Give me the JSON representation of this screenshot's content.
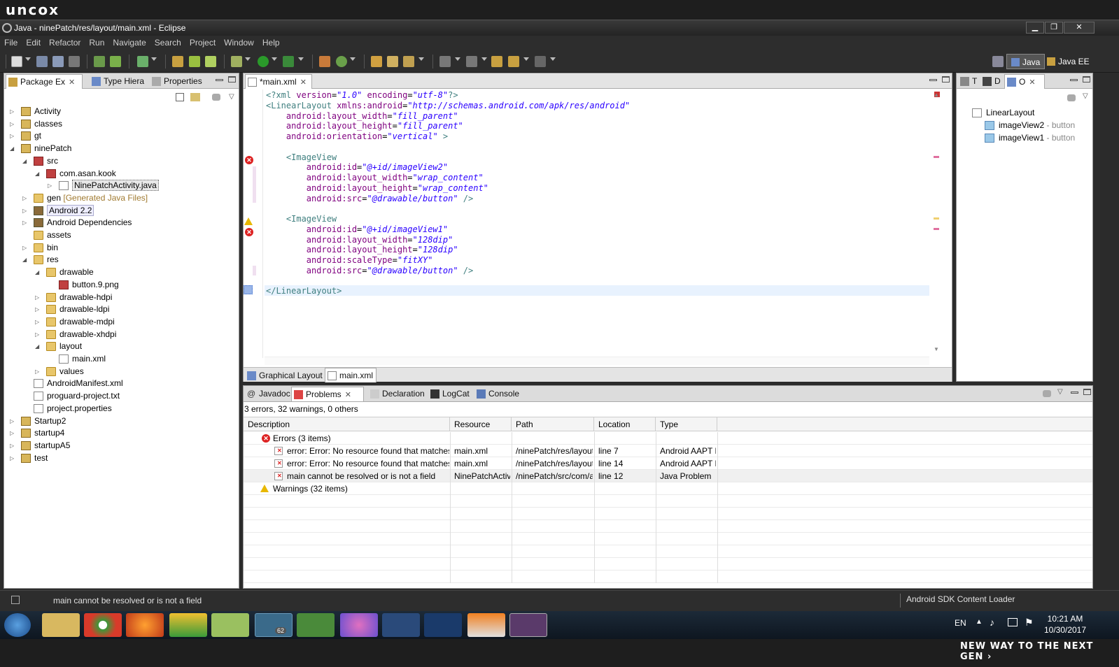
{
  "brand": {
    "logo": "uncox",
    "tagline": "NEW WAY TO THE NEXT GEN ›"
  },
  "window": {
    "title": "Java - ninePatch/res/layout/main.xml - Eclipse",
    "min": "▁",
    "max": "❐",
    "close": "✕"
  },
  "menu": [
    "File",
    "Edit",
    "Refactor",
    "Run",
    "Navigate",
    "Search",
    "Project",
    "Window",
    "Help"
  ],
  "perspectives": {
    "java": "Java",
    "javaee": "Java EE"
  },
  "left_panel": {
    "tabs": [
      {
        "label": "Package Ex"
      },
      {
        "label": "Type Hiera"
      },
      {
        "label": "Properties"
      }
    ],
    "tree": [
      {
        "label": "Activity",
        "level": 0,
        "twisty": "▷",
        "icon": "proj"
      },
      {
        "label": "classes",
        "level": 0,
        "twisty": "▷",
        "icon": "proj"
      },
      {
        "label": "gt",
        "level": 0,
        "twisty": "▷",
        "icon": "proj"
      },
      {
        "label": "ninePatch",
        "level": 0,
        "twisty": "◢",
        "icon": "proj"
      },
      {
        "label": "src",
        "level": 1,
        "twisty": "◢",
        "icon": "pkg"
      },
      {
        "label": "com.asan.kook",
        "level": 2,
        "twisty": "◢",
        "icon": "pkg"
      },
      {
        "label": "NinePatchActivity.java",
        "level": 3,
        "twisty": "▷",
        "icon": "java",
        "selected": true
      },
      {
        "label": "gen",
        "extra": "[Generated Java Files]",
        "level": 1,
        "twisty": "▷",
        "icon": "folder"
      },
      {
        "label": "Android 2.2",
        "level": 1,
        "twisty": "▷",
        "icon": "lib",
        "boxed": true
      },
      {
        "label": "Android Dependencies",
        "level": 1,
        "twisty": "▷",
        "icon": "lib"
      },
      {
        "label": "assets",
        "level": 1,
        "twisty": "",
        "icon": "folder"
      },
      {
        "label": "bin",
        "level": 1,
        "twisty": "▷",
        "icon": "folder"
      },
      {
        "label": "res",
        "level": 1,
        "twisty": "◢",
        "icon": "folder"
      },
      {
        "label": "drawable",
        "level": 2,
        "twisty": "◢",
        "icon": "folder"
      },
      {
        "label": "button.9.png",
        "level": 3,
        "twisty": "",
        "icon": "png"
      },
      {
        "label": "drawable-hdpi",
        "level": 2,
        "twisty": "▷",
        "icon": "folder"
      },
      {
        "label": "drawable-ldpi",
        "level": 2,
        "twisty": "▷",
        "icon": "folder"
      },
      {
        "label": "drawable-mdpi",
        "level": 2,
        "twisty": "▷",
        "icon": "folder"
      },
      {
        "label": "drawable-xhdpi",
        "level": 2,
        "twisty": "▷",
        "icon": "folder"
      },
      {
        "label": "layout",
        "level": 2,
        "twisty": "◢",
        "icon": "folder"
      },
      {
        "label": "main.xml",
        "level": 3,
        "twisty": "",
        "icon": "xml"
      },
      {
        "label": "values",
        "level": 2,
        "twisty": "▷",
        "icon": "folder"
      },
      {
        "label": "AndroidManifest.xml",
        "level": 1,
        "twisty": "",
        "icon": "xml"
      },
      {
        "label": "proguard-project.txt",
        "level": 1,
        "twisty": "",
        "icon": "xml"
      },
      {
        "label": "project.properties",
        "level": 1,
        "twisty": "",
        "icon": "xml"
      },
      {
        "label": "Startup2",
        "level": 0,
        "twisty": "▷",
        "icon": "proj"
      },
      {
        "label": "startup4",
        "level": 0,
        "twisty": "▷",
        "icon": "proj"
      },
      {
        "label": "startupA5",
        "level": 0,
        "twisty": "▷",
        "icon": "proj"
      },
      {
        "label": "test",
        "level": 0,
        "twisty": "▷",
        "icon": "proj"
      }
    ]
  },
  "editor": {
    "tab_label": "*main.xml",
    "bottom_tabs": [
      "Graphical Layout",
      "main.xml"
    ],
    "lines": [
      [
        [
          "pi",
          "<?xml "
        ],
        [
          "attr",
          "version"
        ],
        [
          "t",
          "="
        ],
        [
          "val",
          "\"1.0\""
        ],
        [
          "t",
          " "
        ],
        [
          "attr",
          "encoding"
        ],
        [
          "t",
          "="
        ],
        [
          "val",
          "\"utf-8\""
        ],
        [
          "pi",
          "?>"
        ]
      ],
      [
        [
          "tag",
          "<LinearLayout "
        ],
        [
          "attr",
          "xmlns:android"
        ],
        [
          "t",
          "="
        ],
        [
          "val",
          "\"http://schemas.android.com/apk/res/android\""
        ]
      ],
      [
        [
          "t",
          "    "
        ],
        [
          "attr",
          "android:layout_width"
        ],
        [
          "t",
          "="
        ],
        [
          "val",
          "\"fill_parent\""
        ]
      ],
      [
        [
          "t",
          "    "
        ],
        [
          "attr",
          "android:layout_height"
        ],
        [
          "t",
          "="
        ],
        [
          "val",
          "\"fill_parent\""
        ]
      ],
      [
        [
          "t",
          "    "
        ],
        [
          "attr",
          "android:orientation"
        ],
        [
          "t",
          "="
        ],
        [
          "val",
          "\"vertical\""
        ],
        [
          "tag",
          " >"
        ]
      ],
      [
        [
          "t",
          ""
        ]
      ],
      [
        [
          "t",
          "    "
        ],
        [
          "tag",
          "<ImageView"
        ]
      ],
      [
        [
          "t",
          "        "
        ],
        [
          "attr",
          "android:id"
        ],
        [
          "t",
          "="
        ],
        [
          "val",
          "\"@+id/imageView2\""
        ]
      ],
      [
        [
          "t",
          "        "
        ],
        [
          "attr",
          "android:layout_width"
        ],
        [
          "t",
          "="
        ],
        [
          "val",
          "\"wrap_content\""
        ]
      ],
      [
        [
          "t",
          "        "
        ],
        [
          "attr",
          "android:layout_height"
        ],
        [
          "t",
          "="
        ],
        [
          "val",
          "\"wrap_content\""
        ]
      ],
      [
        [
          "t",
          "        "
        ],
        [
          "attr",
          "android:src"
        ],
        [
          "t",
          "="
        ],
        [
          "val",
          "\"@drawable/button\""
        ],
        [
          "tag",
          " />"
        ]
      ],
      [
        [
          "t",
          ""
        ]
      ],
      [
        [
          "t",
          "    "
        ],
        [
          "tag",
          "<ImageView"
        ]
      ],
      [
        [
          "t",
          "        "
        ],
        [
          "attr",
          "android:id"
        ],
        [
          "t",
          "="
        ],
        [
          "val",
          "\"@+id/imageView1\""
        ]
      ],
      [
        [
          "t",
          "        "
        ],
        [
          "attr",
          "android:layout_width"
        ],
        [
          "t",
          "="
        ],
        [
          "val",
          "\"128dip\""
        ]
      ],
      [
        [
          "t",
          "        "
        ],
        [
          "attr",
          "android:layout_height"
        ],
        [
          "t",
          "="
        ],
        [
          "val",
          "\"128dip\""
        ]
      ],
      [
        [
          "t",
          "        "
        ],
        [
          "attr",
          "android:scaleType"
        ],
        [
          "t",
          "="
        ],
        [
          "val",
          "\"fitXY\""
        ]
      ],
      [
        [
          "t",
          "        "
        ],
        [
          "attr",
          "android:src"
        ],
        [
          "t",
          "="
        ],
        [
          "val",
          "\"@drawable/button\""
        ],
        [
          "tag",
          " />"
        ]
      ],
      [
        [
          "t",
          ""
        ]
      ],
      [
        [
          "tag",
          "</LinearLayout>"
        ]
      ]
    ]
  },
  "outline": {
    "tabs": [
      "T",
      "D",
      "O"
    ],
    "root": "LinearLayout",
    "items": [
      {
        "name": "imageView2",
        "type": " - button"
      },
      {
        "name": "imageView1",
        "type": " - button"
      }
    ]
  },
  "bottom_panel": {
    "tabs": [
      "Javadoc",
      "Problems",
      "Declaration",
      "LogCat",
      "Console"
    ],
    "summary": "3 errors, 32 warnings, 0 others",
    "columns": [
      "Description",
      "Resource",
      "Path",
      "Location",
      "Type"
    ],
    "groups": {
      "errors": "Errors (3 items)",
      "warnings": "Warnings (32 items)"
    },
    "rows": [
      {
        "description": "error: Error: No resource found that matches the given name",
        "resource": "main.xml",
        "path": "/ninePatch/res/layout",
        "location": "line 7",
        "type": "Android AAPT Problem"
      },
      {
        "description": "error: Error: No resource found that matches the given name",
        "resource": "main.xml",
        "path": "/ninePatch/res/layout",
        "location": "line 14",
        "type": "Android AAPT Problem"
      },
      {
        "description": "main cannot be resolved or is not a field",
        "resource": "NinePatchActivity.java",
        "path": "/ninePatch/src/com/asan/kook",
        "location": "line 12",
        "type": "Java Problem"
      }
    ]
  },
  "status": {
    "message": "main cannot be resolved or is not a field",
    "right": "Android SDK Content Loader"
  },
  "taskbar": {
    "lang": "EN",
    "time": "10:21 AM",
    "date": "10/30/2017",
    "telegram_badge": "62",
    "apps": [
      "explorer-icon",
      "chrome-icon",
      "firefox-icon",
      "bluestacks-icon",
      "notepad-icon",
      "telegram-icon",
      "gamepad-icon",
      "itunes-icon",
      "photoshop-cs-icon",
      "photoshop-icon",
      "vlc-icon",
      "javaee-ide-icon"
    ]
  }
}
